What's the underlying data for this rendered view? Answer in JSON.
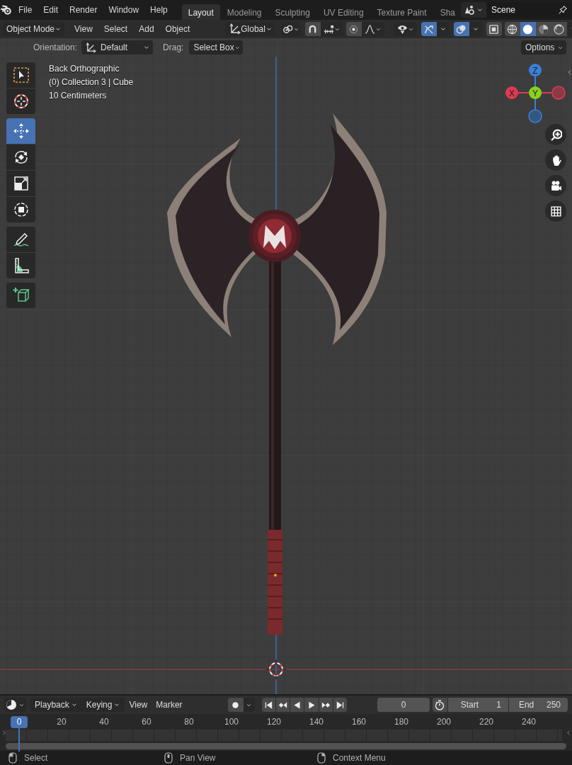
{
  "top_bar": {
    "menus": [
      "File",
      "Edit",
      "Render",
      "Window",
      "Help"
    ],
    "workspaces": [
      {
        "label": "Layout",
        "selected": true
      },
      {
        "label": "Modeling",
        "selected": false
      },
      {
        "label": "Sculpting",
        "selected": false
      },
      {
        "label": "UV Editing",
        "selected": false
      },
      {
        "label": "Texture Paint",
        "selected": false
      },
      {
        "label": "Sha",
        "selected": false
      }
    ],
    "scene": "Scene"
  },
  "viewport_header": {
    "mode": "Object Mode",
    "menus": [
      "View",
      "Select",
      "Add",
      "Object"
    ],
    "orientation": "Global",
    "toggles": [
      {
        "kind": "snap",
        "on": false
      },
      {
        "kind": "proportional",
        "on": false
      },
      {
        "kind": "visibility",
        "on": false
      },
      {
        "kind": "gizmo",
        "on": true
      },
      {
        "kind": "overlay",
        "on": true
      },
      {
        "kind": "xray",
        "on": false
      }
    ],
    "shading": [
      {
        "kind": "wireframe",
        "selected": false
      },
      {
        "kind": "solid",
        "selected": true
      },
      {
        "kind": "material",
        "selected": false
      },
      {
        "kind": "rendered",
        "selected": false
      }
    ]
  },
  "tool_settings": {
    "orientation_label": "Orientation:",
    "orientation": "Default",
    "drag_label": "Drag:",
    "drag": "Select Box",
    "options": "Options"
  },
  "viewport": {
    "overlay_text": [
      "Back Orthographic",
      "(0) Collection 3 | Cube",
      "10 Centimeters"
    ],
    "tool_groups": [
      {
        "tools": [
          {
            "kind": "select_box",
            "selected": false
          },
          {
            "kind": "cursor",
            "selected": false
          }
        ]
      },
      {
        "tools": [
          {
            "kind": "move",
            "selected": true
          },
          {
            "kind": "rotate",
            "selected": false
          },
          {
            "kind": "scale",
            "selected": false
          },
          {
            "kind": "transform",
            "selected": false
          }
        ]
      },
      {
        "tools": [
          {
            "kind": "annotate",
            "selected": false
          },
          {
            "kind": "measure",
            "selected": false
          }
        ]
      },
      {
        "tools": [
          {
            "kind": "add_cube",
            "selected": false
          }
        ]
      }
    ],
    "gizmo": [
      {
        "kind": "neg_x"
      },
      {
        "kind": "neg_z"
      },
      {
        "kind": "z",
        "label": "Z"
      },
      {
        "kind": "x",
        "label": "X"
      },
      {
        "kind": "y",
        "label": "Y"
      }
    ],
    "navigation": [
      {
        "kind": "zoom"
      },
      {
        "kind": "pan"
      },
      {
        "kind": "camera"
      },
      {
        "kind": "grid"
      }
    ]
  },
  "timeline": {
    "menus": [
      {
        "label": "Playback",
        "kind": "dropdown"
      },
      {
        "label": "Keying",
        "kind": "dropdown"
      },
      {
        "label": "View",
        "kind": "menu"
      },
      {
        "label": "Marker",
        "kind": "menu"
      }
    ],
    "current_frame": "0",
    "start_label": "Start",
    "start": "1",
    "end_label": "End",
    "end": "250",
    "playhead": "0",
    "ruler": [
      "20",
      "40",
      "60",
      "80",
      "100",
      "120",
      "140",
      "160",
      "180",
      "200",
      "220",
      "240"
    ]
  },
  "status_bar": [
    {
      "kind": "left_click",
      "label": "Select"
    },
    {
      "kind": "middle_click",
      "label": "Pan View"
    },
    {
      "kind": "right_click",
      "label": "Context Menu"
    }
  ]
}
